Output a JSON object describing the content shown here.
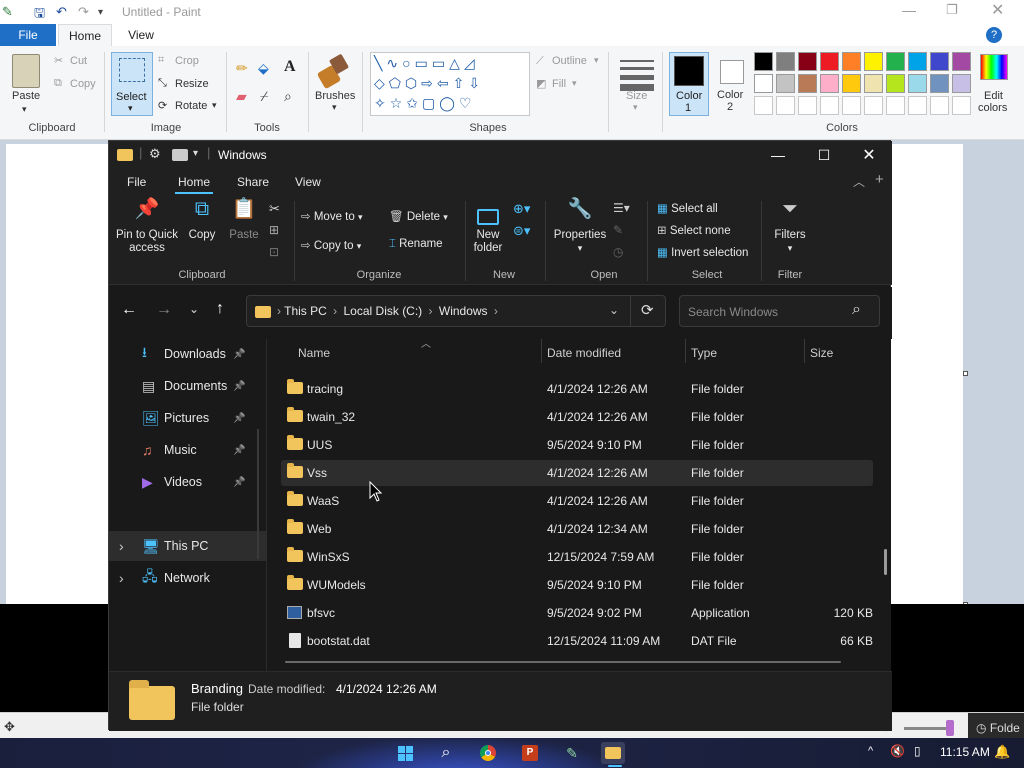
{
  "paint": {
    "title": "Untitled - Paint",
    "tabs": [
      "File",
      "Home",
      "View"
    ],
    "clipboard": {
      "paste": "Paste",
      "cut": "Cut",
      "copy": "Copy",
      "label": "Clipboard"
    },
    "image": {
      "select": "Select",
      "crop": "Crop",
      "resize": "Resize",
      "rotate": "Rotate",
      "label": "Image"
    },
    "tools": {
      "label": "Tools"
    },
    "brushes": {
      "label": "Brushes"
    },
    "shapes": {
      "label": "Shapes",
      "outline": "Outline",
      "fill": "Fill"
    },
    "size": {
      "label": "Size"
    },
    "color1": {
      "label_line1": "Color",
      "label_line2": "1"
    },
    "color2": {
      "label_line1": "Color",
      "label_line2": "2"
    },
    "colors": {
      "label": "Colors",
      "edit_line1": "Edit",
      "edit_line2": "colors"
    },
    "palette_row1": [
      "#000000",
      "#7f7f7f",
      "#880015",
      "#ed1c24",
      "#ff7f27",
      "#fff200",
      "#22b14c",
      "#00a2e8",
      "#3f48cc",
      "#a349a4"
    ],
    "palette_row2": [
      "#ffffff",
      "#c3c3c3",
      "#b97a57",
      "#ffaec9",
      "#ffc90e",
      "#efe4b0",
      "#b5e61d",
      "#99d9ea",
      "#7092be",
      "#c8bfe7"
    ],
    "status_zoom_label": "Folde"
  },
  "explorer": {
    "title": "Windows",
    "tabs": [
      "File",
      "Home",
      "Share",
      "View"
    ],
    "ribbon": {
      "pin_line1": "Pin to Quick",
      "pin_line2": "access",
      "copy": "Copy",
      "paste": "Paste",
      "clipboard_label": "Clipboard",
      "move_to": "Move to",
      "copy_to": "Copy to",
      "delete": "Delete",
      "rename": "Rename",
      "organize_label": "Organize",
      "new_folder_line1": "New",
      "new_folder_line2": "folder",
      "new_label": "New",
      "properties": "Properties",
      "open_label": "Open",
      "select_all": "Select all",
      "select_none": "Select none",
      "invert_selection": "Invert selection",
      "select_label": "Select",
      "filters": "Filters",
      "filter_label": "Filter"
    },
    "breadcrumb": [
      "This PC",
      "Local Disk (C:)",
      "Windows"
    ],
    "search_placeholder": "Search Windows",
    "nav": [
      {
        "label": "Downloads",
        "icon": "download-icon",
        "pinned": true
      },
      {
        "label": "Documents",
        "icon": "document-icon",
        "pinned": true
      },
      {
        "label": "Pictures",
        "icon": "picture-icon",
        "pinned": true
      },
      {
        "label": "Music",
        "icon": "music-icon",
        "pinned": true
      },
      {
        "label": "Videos",
        "icon": "video-icon",
        "pinned": true
      },
      {
        "label": "This PC",
        "icon": "computer-icon"
      },
      {
        "label": "Network",
        "icon": "network-icon"
      }
    ],
    "columns": {
      "name": "Name",
      "date": "Date modified",
      "type": "Type",
      "size": "Size"
    },
    "files": [
      {
        "name": "tracing",
        "date": "4/1/2024 12:26 AM",
        "type": "File folder",
        "size": "",
        "kind": "folder"
      },
      {
        "name": "twain_32",
        "date": "4/1/2024 12:26 AM",
        "type": "File folder",
        "size": "",
        "kind": "folder"
      },
      {
        "name": "UUS",
        "date": "9/5/2024 9:10 PM",
        "type": "File folder",
        "size": "",
        "kind": "folder"
      },
      {
        "name": "Vss",
        "date": "4/1/2024 12:26 AM",
        "type": "File folder",
        "size": "",
        "kind": "folder",
        "hover": true
      },
      {
        "name": "WaaS",
        "date": "4/1/2024 12:26 AM",
        "type": "File folder",
        "size": "",
        "kind": "folder"
      },
      {
        "name": "Web",
        "date": "4/1/2024 12:34 AM",
        "type": "File folder",
        "size": "",
        "kind": "folder"
      },
      {
        "name": "WinSxS",
        "date": "12/15/2024 7:59 AM",
        "type": "File folder",
        "size": "",
        "kind": "folder"
      },
      {
        "name": "WUModels",
        "date": "9/5/2024 9:10 PM",
        "type": "File folder",
        "size": "",
        "kind": "folder"
      },
      {
        "name": "bfsvc",
        "date": "9/5/2024 9:02 PM",
        "type": "Application",
        "size": "120 KB",
        "kind": "app"
      },
      {
        "name": "bootstat.dat",
        "date": "12/15/2024 11:09 AM",
        "type": "DAT File",
        "size": "66 KB",
        "kind": "file"
      }
    ],
    "details": {
      "name": "Branding",
      "date_label": "Date modified:",
      "date_value": "4/1/2024 12:26 AM",
      "type": "File folder"
    }
  },
  "taskbar": {
    "time": "11:15 AM"
  }
}
